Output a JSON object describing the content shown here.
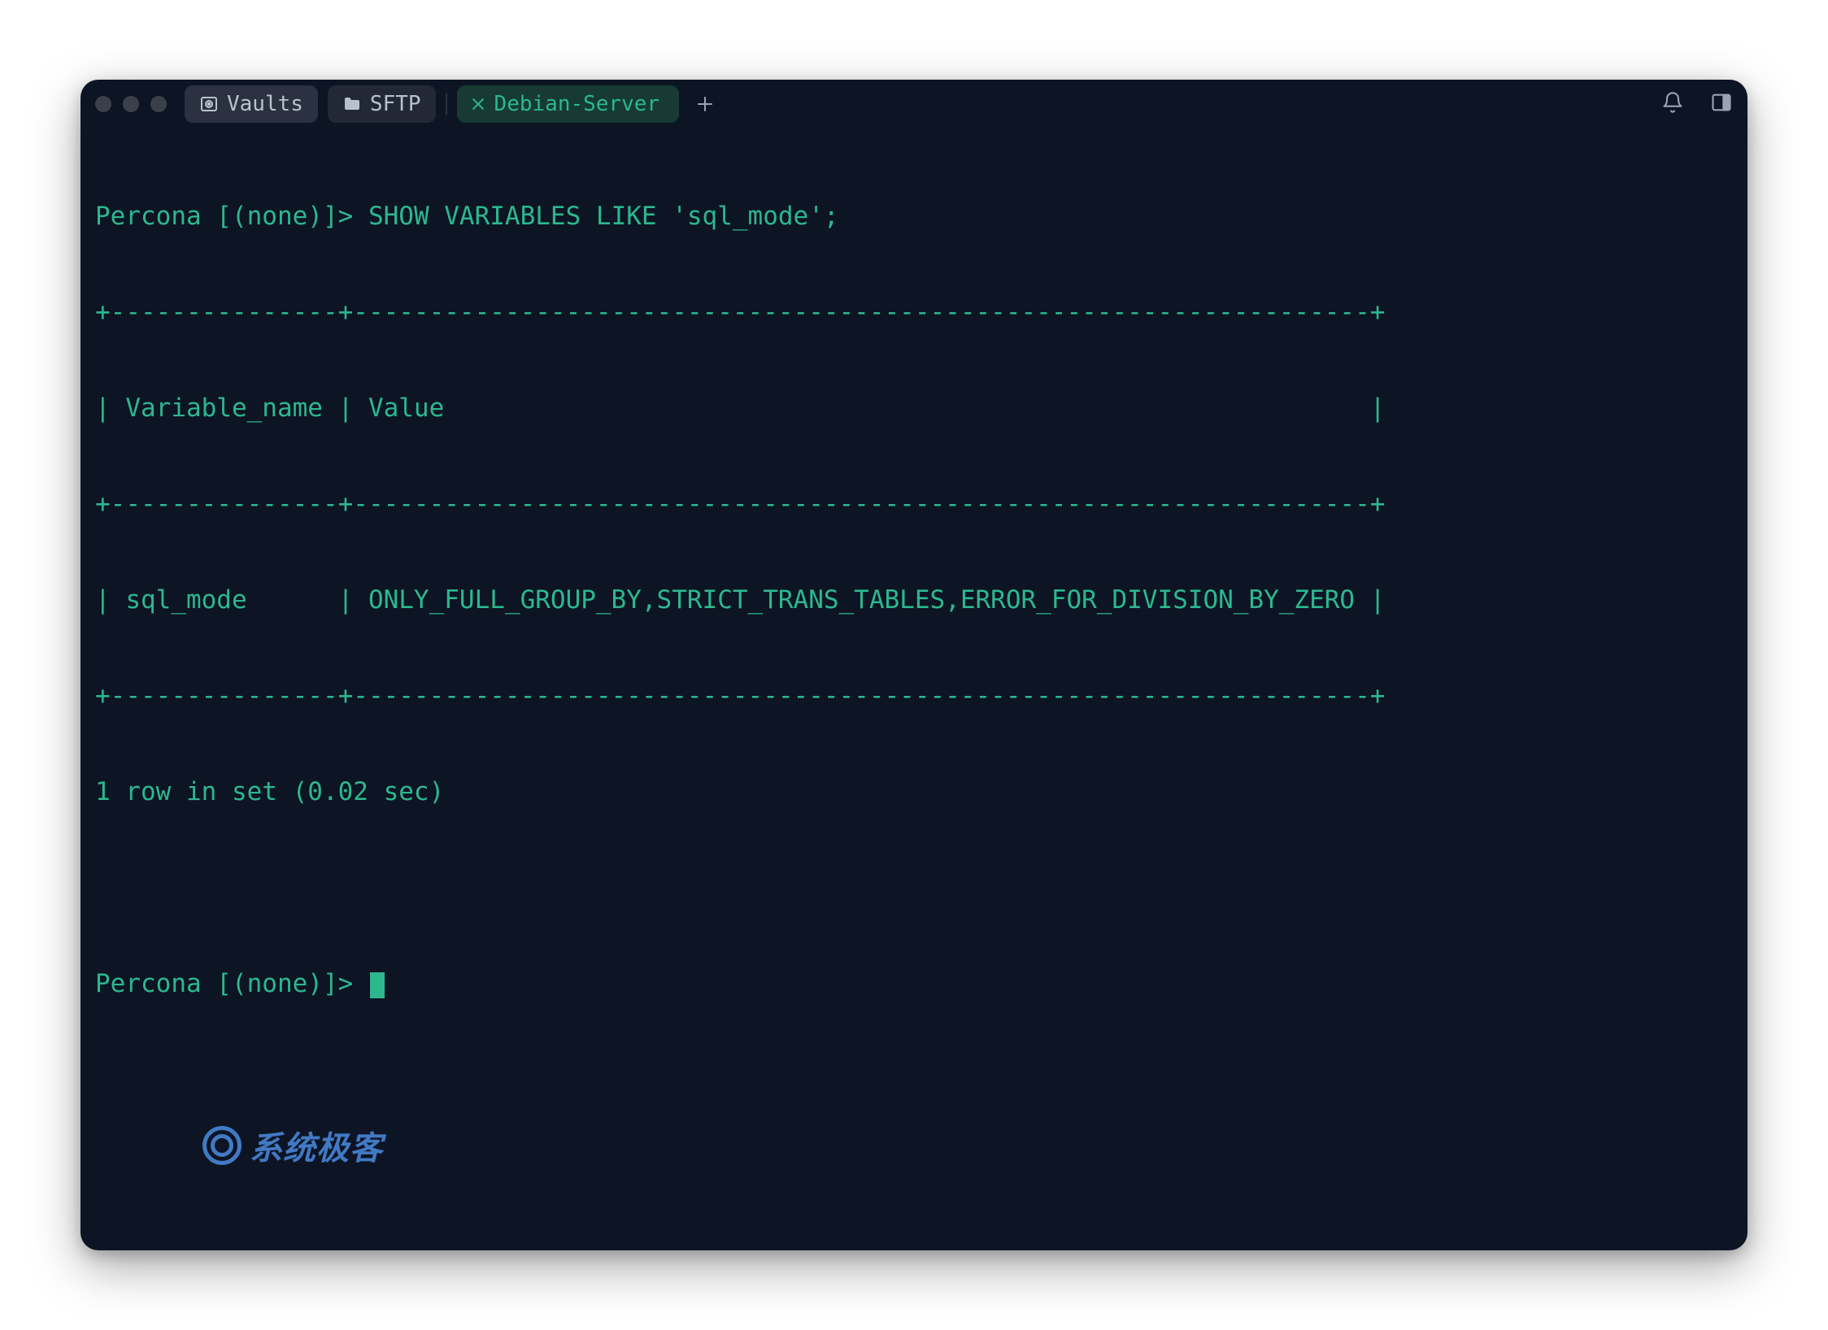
{
  "tabs": {
    "vaults_label": "Vaults",
    "sftp_label": "SFTP",
    "debian_label": "Debian-Server"
  },
  "term": {
    "prompt1": "Percona [(none)]> ",
    "cmd1": "SHOW VARIABLES LIKE 'sql_mode';",
    "rule": "+---------------+-------------------------------------------------------------------+",
    "hdr": "| Variable_name | Value                                                             |",
    "row": "| sql_mode      | ONLY_FULL_GROUP_BY,STRICT_TRANS_TABLES,ERROR_FOR_DIVISION_BY_ZERO |",
    "status": "1 row in set (0.02 sec)",
    "prompt2": "Percona [(none)]> "
  },
  "watermark": {
    "text": "系统极客"
  }
}
